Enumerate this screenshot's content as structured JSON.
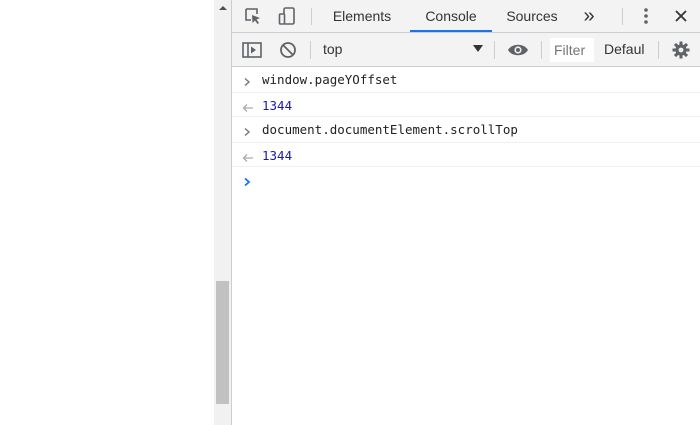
{
  "devtools": {
    "tabs": [
      {
        "label": "Elements",
        "active": false
      },
      {
        "label": "Console",
        "active": true
      },
      {
        "label": "Sources",
        "active": false
      }
    ],
    "more_tabs_label": "»",
    "icons": {
      "inspect": "inspect-element-icon",
      "device": "device-toolbar-icon",
      "more_tabs": "chevron-double-right-icon",
      "menu": "kebab-menu-icon",
      "close": "close-icon"
    },
    "toolbar": {
      "context": "top",
      "filter_placeholder": "Filter",
      "levels": "Defaul",
      "icons": {
        "sidebar": "sidebar-toggle-icon",
        "clear": "clear-console-icon",
        "dropdown": "dropdown-arrow-icon",
        "live_expression": "eye-icon",
        "settings": "gear-icon"
      }
    },
    "console": {
      "entries": [
        {
          "type": "input",
          "text": "window.pageYOffset"
        },
        {
          "type": "result",
          "text": "1344"
        },
        {
          "type": "input",
          "text": "document.documentElement.scrollTop"
        },
        {
          "type": "result",
          "text": "1344"
        }
      ],
      "prompt_icon": "prompt-chevron-icon"
    },
    "colors": {
      "accent": "#1a73e8",
      "number": "#1a1aa6",
      "toolbar_bg": "#f3f3f3",
      "border": "#cbcdd1"
    }
  }
}
